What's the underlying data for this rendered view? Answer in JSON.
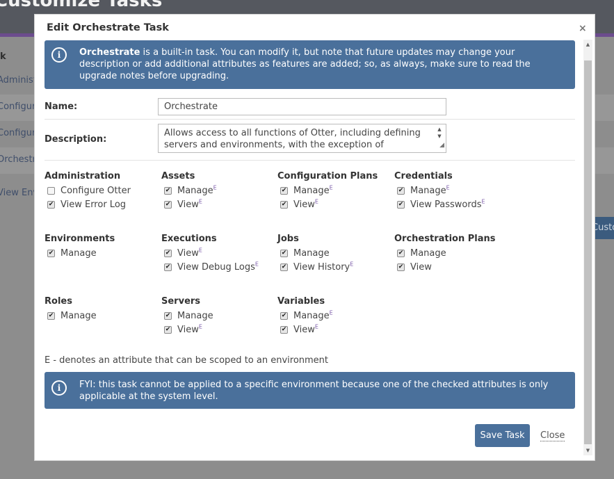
{
  "background": {
    "page_title": "Customize Tasks",
    "column_header": "k",
    "rows": [
      "Administer",
      "Configure E",
      "Configure E",
      "Orchestrate",
      "View Enviro"
    ],
    "side_button": "Custom"
  },
  "modal": {
    "title": "Edit Orchestrate Task",
    "close_icon": "×",
    "info_top": {
      "bold": "Orchestrate",
      "text": " is a built-in task. You can modify it, but note that future updates may change your description or add additional attributes as features are added; so, as always, make sure to read the upgrade notes before upgrading."
    },
    "name_label": "Name:",
    "name_value": "Orchestrate",
    "description_label": "Description:",
    "description_value": "Allows access to all functions of Otter, including defining servers and environments, with the exception of",
    "groups": [
      {
        "title": "Administration",
        "items": [
          {
            "label": "Configure Otter",
            "checked": false,
            "scoped": false
          },
          {
            "label": "View Error Log",
            "checked": true,
            "scoped": false
          }
        ]
      },
      {
        "title": "Assets",
        "items": [
          {
            "label": "Manage",
            "checked": true,
            "scoped": true
          },
          {
            "label": "View",
            "checked": true,
            "scoped": true
          }
        ]
      },
      {
        "title": "Configuration Plans",
        "items": [
          {
            "label": "Manage",
            "checked": true,
            "scoped": true
          },
          {
            "label": "View",
            "checked": true,
            "scoped": true
          }
        ]
      },
      {
        "title": "Credentials",
        "items": [
          {
            "label": "Manage",
            "checked": true,
            "scoped": true
          },
          {
            "label": "View Passwords",
            "checked": true,
            "scoped": true
          }
        ]
      },
      {
        "title": "Environments",
        "items": [
          {
            "label": "Manage",
            "checked": true,
            "scoped": false
          }
        ]
      },
      {
        "title": "Executions",
        "items": [
          {
            "label": "View",
            "checked": true,
            "scoped": true
          },
          {
            "label": "View Debug Logs",
            "checked": true,
            "scoped": true
          }
        ]
      },
      {
        "title": "Jobs",
        "items": [
          {
            "label": "Manage",
            "checked": true,
            "scoped": false
          },
          {
            "label": "View History",
            "checked": true,
            "scoped": true
          }
        ]
      },
      {
        "title": "Orchestration Plans",
        "items": [
          {
            "label": "Manage",
            "checked": true,
            "scoped": false
          },
          {
            "label": "View",
            "checked": true,
            "scoped": false
          }
        ]
      },
      {
        "title": "Roles",
        "items": [
          {
            "label": "Manage",
            "checked": true,
            "scoped": false
          }
        ]
      },
      {
        "title": "Servers",
        "items": [
          {
            "label": "Manage",
            "checked": true,
            "scoped": false
          },
          {
            "label": "View",
            "checked": true,
            "scoped": true
          }
        ]
      },
      {
        "title": "Variables",
        "items": [
          {
            "label": "Manage",
            "checked": true,
            "scoped": true
          },
          {
            "label": "View",
            "checked": true,
            "scoped": true
          }
        ]
      }
    ],
    "scope_marker": "E",
    "legend": "E - denotes an attribute that can be scoped to an environment",
    "info_bottom": "FYI: this task cannot be applied to a specific environment because one of the checked attributes is only applicable at the system level.",
    "info_icon": "i",
    "save_label": "Save Task",
    "close_label": "Close"
  },
  "colors": {
    "accent": "#4a709b",
    "scope_marker": "#7a5aa8",
    "header_bg": "#55585f",
    "header_stripe": "#6c4c8e"
  }
}
